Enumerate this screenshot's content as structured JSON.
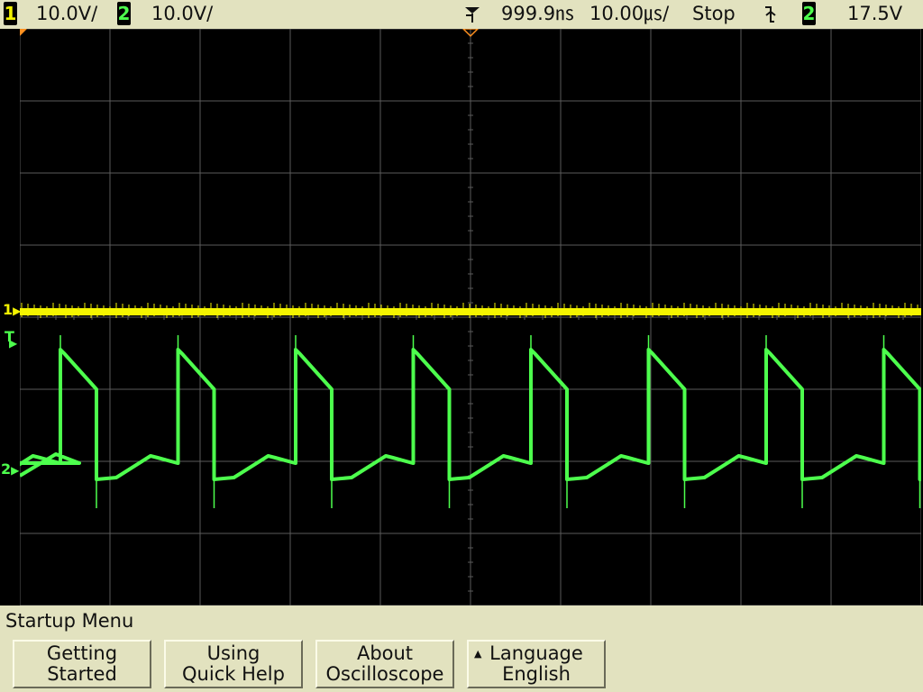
{
  "topbar": {
    "ch1_number": "1",
    "ch1_scale": "10.0V/",
    "ch2_number": "2",
    "ch2_scale": "10.0V/",
    "delay": "999.9㎱",
    "timebase": "10.00㎲/",
    "run_state": "Stop",
    "trigger_source": "2",
    "trigger_level": "17.5V"
  },
  "markers": {
    "ch1_label": "1",
    "trigger_label": "T",
    "ch2_label": "2"
  },
  "menu": {
    "title": "Startup Menu",
    "softkeys": [
      {
        "line1": "Getting",
        "line2": "Started"
      },
      {
        "line1": "Using",
        "line2": "Quick Help"
      },
      {
        "line1": "About",
        "line2": "Oscilloscope"
      },
      {
        "line1": "Language",
        "line2": "English",
        "icon": "up-triangle-icon"
      }
    ]
  },
  "colors": {
    "ch1": "#f4f400",
    "ch2": "#4dff4d",
    "grid": "#5a5a5a",
    "bezel": "#e2e2bf",
    "trigger_delay_marker": "#ff9020"
  }
}
